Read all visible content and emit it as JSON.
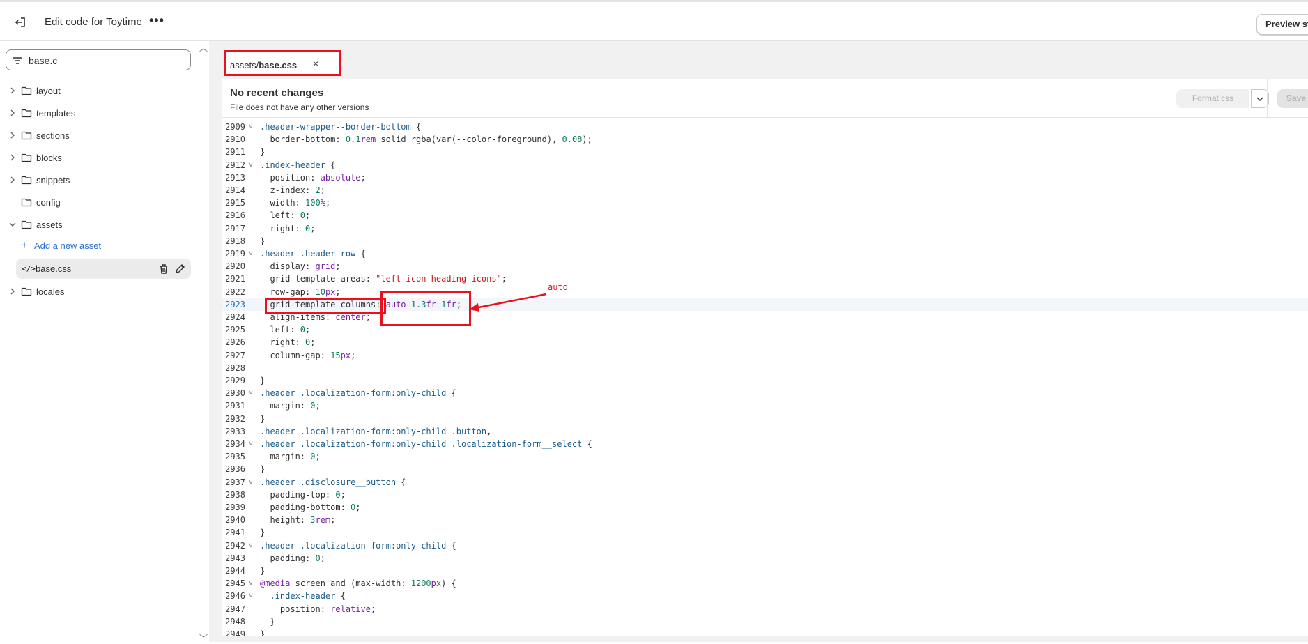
{
  "header": {
    "title": "Edit code for Toytime",
    "preview_label": "Preview sto"
  },
  "sidebar": {
    "search_value": "base.c",
    "items": [
      {
        "label": "layout",
        "expandable": true
      },
      {
        "label": "templates",
        "expandable": true
      },
      {
        "label": "sections",
        "expandable": true
      },
      {
        "label": "blocks",
        "expandable": true
      },
      {
        "label": "snippets",
        "expandable": true
      },
      {
        "label": "config",
        "expandable": false
      },
      {
        "label": "assets",
        "expanded": true
      },
      {
        "label": "locales",
        "expandable": true
      }
    ],
    "add_asset_label": "Add a new asset",
    "file_label": "base.css"
  },
  "tab": {
    "prefix": "assets/",
    "name": "base.css",
    "close": "×"
  },
  "info": {
    "heading": "No recent changes",
    "sub": "File does not have any other versions",
    "format_label": "Format css",
    "save_label": "Save"
  },
  "annotation": {
    "label": "auto"
  },
  "code": {
    "active_line": "2923",
    "lines": [
      {
        "n": "2909",
        "fold": true,
        "text": ".header-wrapper--border-bottom {"
      },
      {
        "n": "2910",
        "text": "  border-bottom: 0.1rem solid rgba(var(--color-foreground), 0.08);"
      },
      {
        "n": "2911",
        "text": "}"
      },
      {
        "n": "2912",
        "fold": true,
        "text": ".index-header {"
      },
      {
        "n": "2913",
        "text": "  position: absolute;"
      },
      {
        "n": "2914",
        "text": "  z-index: 2;"
      },
      {
        "n": "2915",
        "text": "  width: 100%;"
      },
      {
        "n": "2916",
        "text": "  left: 0;"
      },
      {
        "n": "2917",
        "text": "  right: 0;"
      },
      {
        "n": "2918",
        "text": "}"
      },
      {
        "n": "2919",
        "fold": true,
        "text": ".header .header-row {"
      },
      {
        "n": "2920",
        "text": "  display: grid;"
      },
      {
        "n": "2921",
        "text": "  grid-template-areas: \"left-icon heading icons\";"
      },
      {
        "n": "2922",
        "text": "  row-gap: 10px;"
      },
      {
        "n": "2923",
        "text": "  grid-template-columns: auto 1.3fr 1fr;"
      },
      {
        "n": "2924",
        "text": "  align-items: center;"
      },
      {
        "n": "2925",
        "text": "  left: 0;"
      },
      {
        "n": "2926",
        "text": "  right: 0;"
      },
      {
        "n": "2927",
        "text": "  column-gap: 15px;"
      },
      {
        "n": "2928",
        "text": ""
      },
      {
        "n": "2929",
        "text": "}"
      },
      {
        "n": "2930",
        "fold": true,
        "text": ".header .localization-form:only-child {"
      },
      {
        "n": "2931",
        "text": "  margin: 0;"
      },
      {
        "n": "2932",
        "text": "}"
      },
      {
        "n": "2933",
        "text": ".header .localization-form:only-child .button,"
      },
      {
        "n": "2934",
        "fold": true,
        "text": ".header .localization-form:only-child .localization-form__select {"
      },
      {
        "n": "2935",
        "text": "  margin: 0;"
      },
      {
        "n": "2936",
        "text": "}"
      },
      {
        "n": "2937",
        "fold": true,
        "text": ".header .disclosure__button {"
      },
      {
        "n": "2938",
        "text": "  padding-top: 0;"
      },
      {
        "n": "2939",
        "text": "  padding-bottom: 0;"
      },
      {
        "n": "2940",
        "text": "  height: 3rem;"
      },
      {
        "n": "2941",
        "text": "}"
      },
      {
        "n": "2942",
        "fold": true,
        "text": ".header .localization-form:only-child {"
      },
      {
        "n": "2943",
        "text": "  padding: 0;"
      },
      {
        "n": "2944",
        "text": "}"
      },
      {
        "n": "2945",
        "fold": true,
        "text": "@media screen and (max-width: 1200px) {"
      },
      {
        "n": "2946",
        "fold": true,
        "text": "  .index-header {"
      },
      {
        "n": "2947",
        "text": "    position: relative;"
      },
      {
        "n": "2948",
        "text": "  }"
      },
      {
        "n": "2949",
        "text": "}"
      }
    ]
  }
}
